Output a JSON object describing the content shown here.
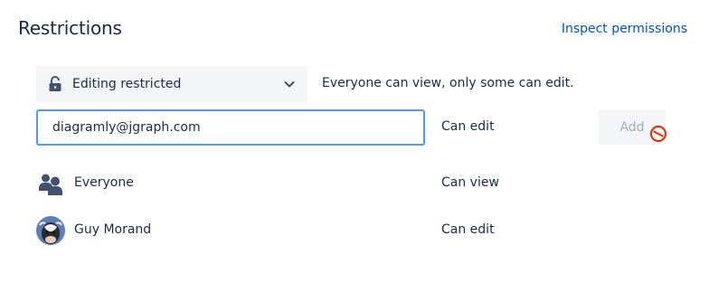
{
  "header": {
    "title": "Restrictions",
    "inspect_link": "Inspect permissions"
  },
  "mode": {
    "selected": "Editing restricted",
    "description": "Everyone can view, only some can edit."
  },
  "add_user": {
    "input_value": "diagramly@jgraph.com",
    "permission": "Can edit",
    "add_label": "Add"
  },
  "entries": [
    {
      "name": "Everyone",
      "permission": "Can view",
      "icon": "people-group-icon"
    },
    {
      "name": "Guy Morand",
      "permission": "Can edit",
      "icon": "avatar"
    }
  ],
  "colors": {
    "link": "#0052cc",
    "focus_border": "#4c9aff",
    "text": "#172b4d",
    "disabled_text": "#a5adba",
    "field_bg": "#f4f5f7",
    "not_allowed": "#de350b"
  }
}
